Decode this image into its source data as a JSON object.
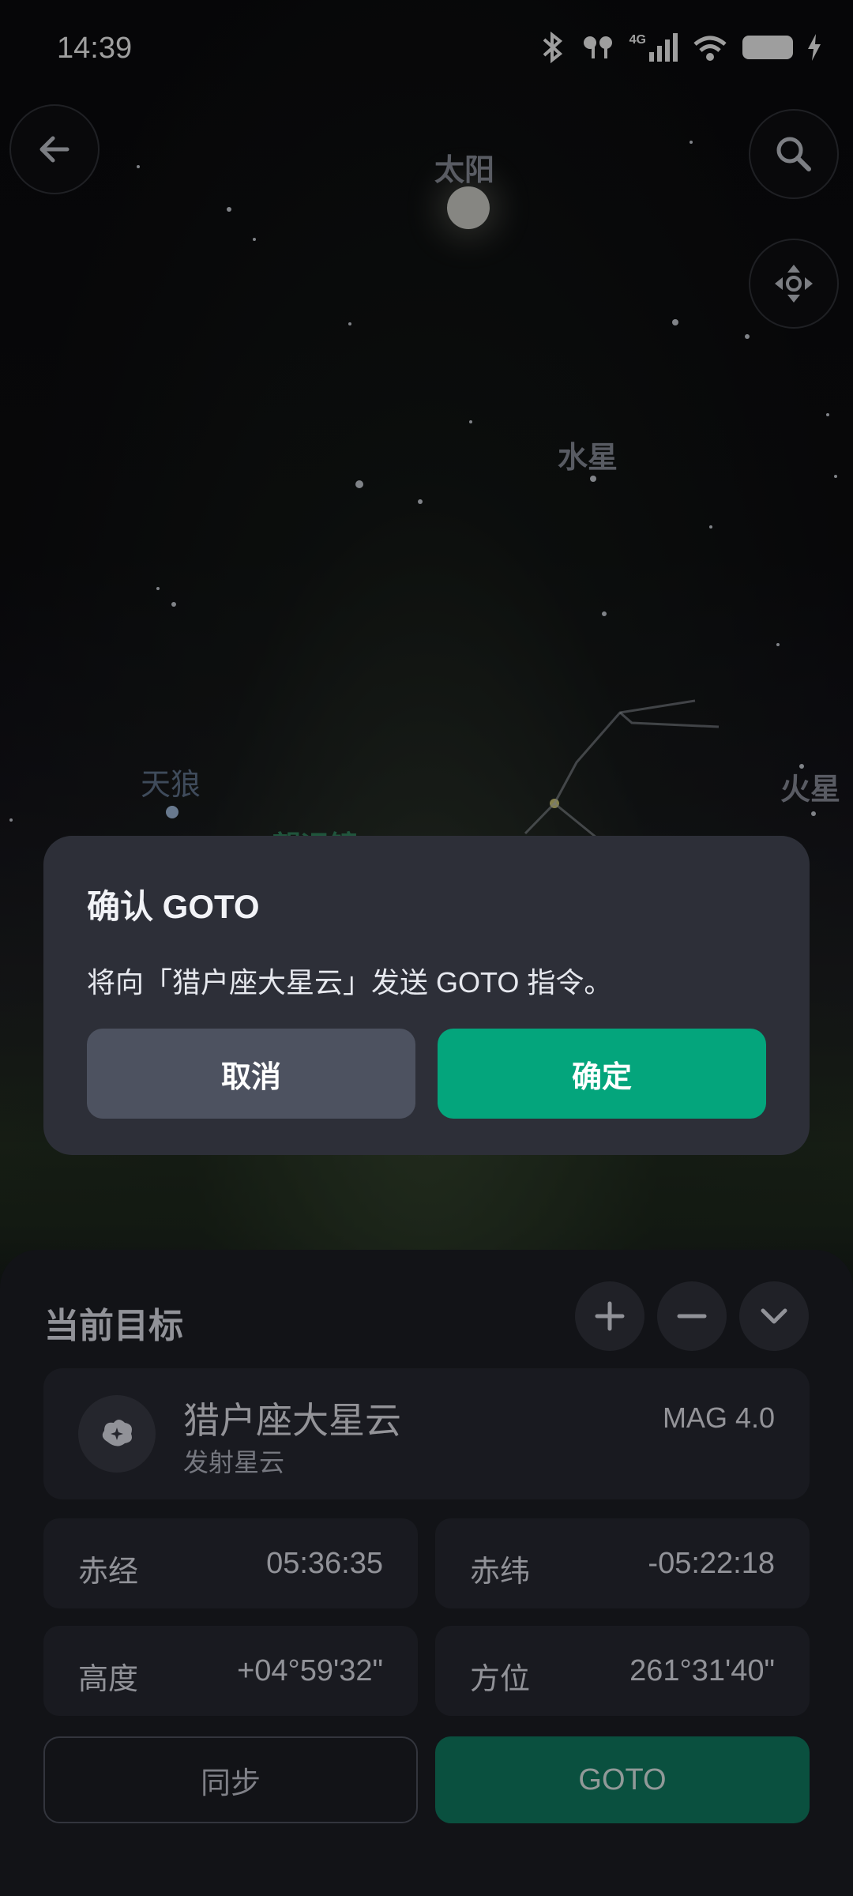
{
  "status_bar": {
    "time": "14:39",
    "network": "4G"
  },
  "sky": {
    "sun": "太阳",
    "mercury": "水星",
    "sirius": "天狼",
    "mars": "火星",
    "telescope": "望远镜"
  },
  "dialog": {
    "title": "确认 GOTO",
    "message": "将向「猎户座大星云」发送 GOTO 指令。",
    "cancel_label": "取消",
    "confirm_label": "确定"
  },
  "sheet": {
    "title": "当前目标",
    "target": {
      "name": "猎户座大星云",
      "type": "发射星云",
      "magnitude": "MAG 4.0"
    },
    "coords": [
      {
        "label": "赤经",
        "value": "05:36:35"
      },
      {
        "label": "赤纬",
        "value": "-05:22:18"
      },
      {
        "label": "高度",
        "value": "+04°59'32\""
      },
      {
        "label": "方位",
        "value": "261°31'40\""
      }
    ],
    "sync_label": "同步",
    "goto_label": "GOTO"
  },
  "colors": {
    "accent": "#04a57c",
    "dialog_bg": "#2d2f38",
    "sheet_bg": "#121317"
  },
  "icons": [
    "back-arrow-icon",
    "search-icon",
    "recenter-icon",
    "plus-icon",
    "minus-icon",
    "chevron-down-icon",
    "nebula-icon"
  ]
}
